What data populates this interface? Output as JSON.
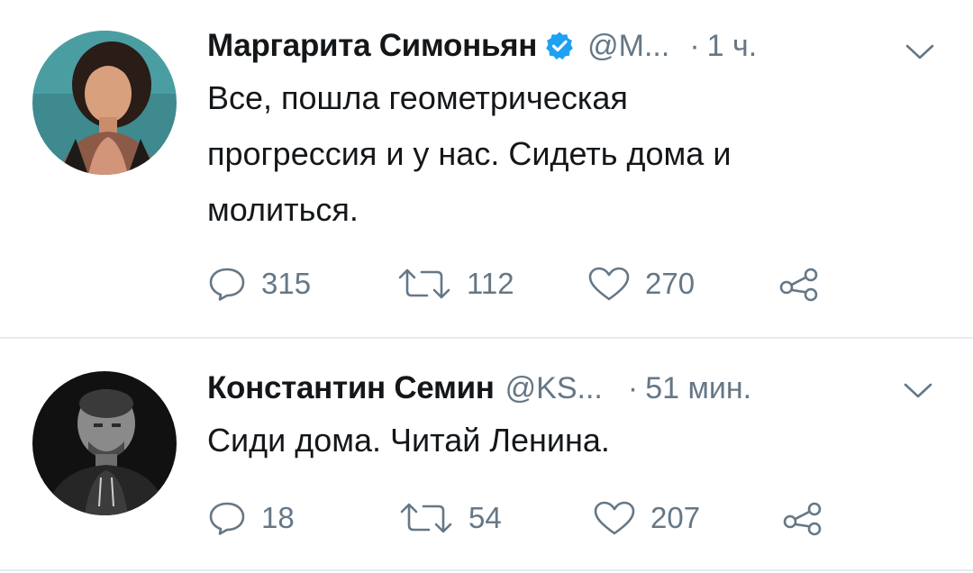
{
  "tweets": [
    {
      "author_name": "Маргарита Симоньян",
      "verified": true,
      "handle": "@М...",
      "separator": "·",
      "time": "1 ч.",
      "text_lines": [
        "Все, пошла геометрическая",
        "прогрессия и у нас. Сидеть дома и",
        "молиться."
      ],
      "replies": "315",
      "retweets": "112",
      "likes": "270"
    },
    {
      "author_name": "Константин Семин",
      "verified": false,
      "handle": "@KS...",
      "separator": "·",
      "time": "51 мин.",
      "text_lines": [
        "Сиди дома. Читай Ленина."
      ],
      "replies": "18",
      "retweets": "54",
      "likes": "207"
    }
  ],
  "icons": {
    "verified": "verified-badge-icon",
    "more": "chevron-down-icon",
    "reply": "reply-icon",
    "retweet": "retweet-icon",
    "like": "heart-icon",
    "share": "share-icon"
  },
  "colors": {
    "text": "#14171a",
    "secondary": "#657786",
    "verified": "#1da1f2",
    "divider": "#e6ecf0"
  }
}
